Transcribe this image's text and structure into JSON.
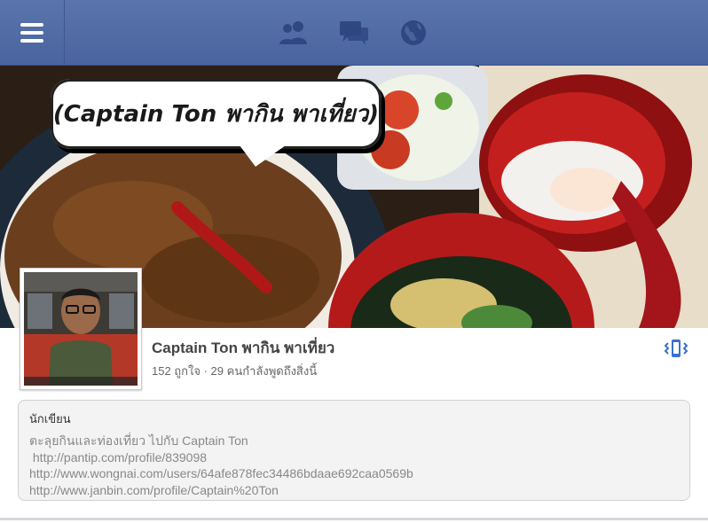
{
  "topbar": {
    "menu_icon": "hamburger-menu-icon",
    "nav": [
      {
        "icon": "friends-icon"
      },
      {
        "icon": "messages-icon"
      },
      {
        "icon": "notifications-globe-icon"
      }
    ]
  },
  "cover": {
    "bubble_text": "(Captain Ton พากิน พาเที่ยว)"
  },
  "page": {
    "name": "Captain Ton พากิน พาเที่ยว",
    "stats": "152 ถูกใจ · 29 คนกำลังพูดถึงสิ่งนี้",
    "vibrate_icon": "vibrate-phone-icon"
  },
  "about": {
    "category": "นักเขียน",
    "lines": [
      "ตะลุยกินและท่องเที่ยว ไปกับ Captain Ton",
      " http://pantip.com/profile/839098",
      "http://www.wongnai.com/users/64afe878fec34486bdaae692caa0569b",
      "http://www.janbin.com/profile/Captain%20Ton"
    ]
  },
  "colors": {
    "topbar": "#4a64a0",
    "nav_icon": "#2f4782",
    "accent": "#3b6fd1"
  }
}
